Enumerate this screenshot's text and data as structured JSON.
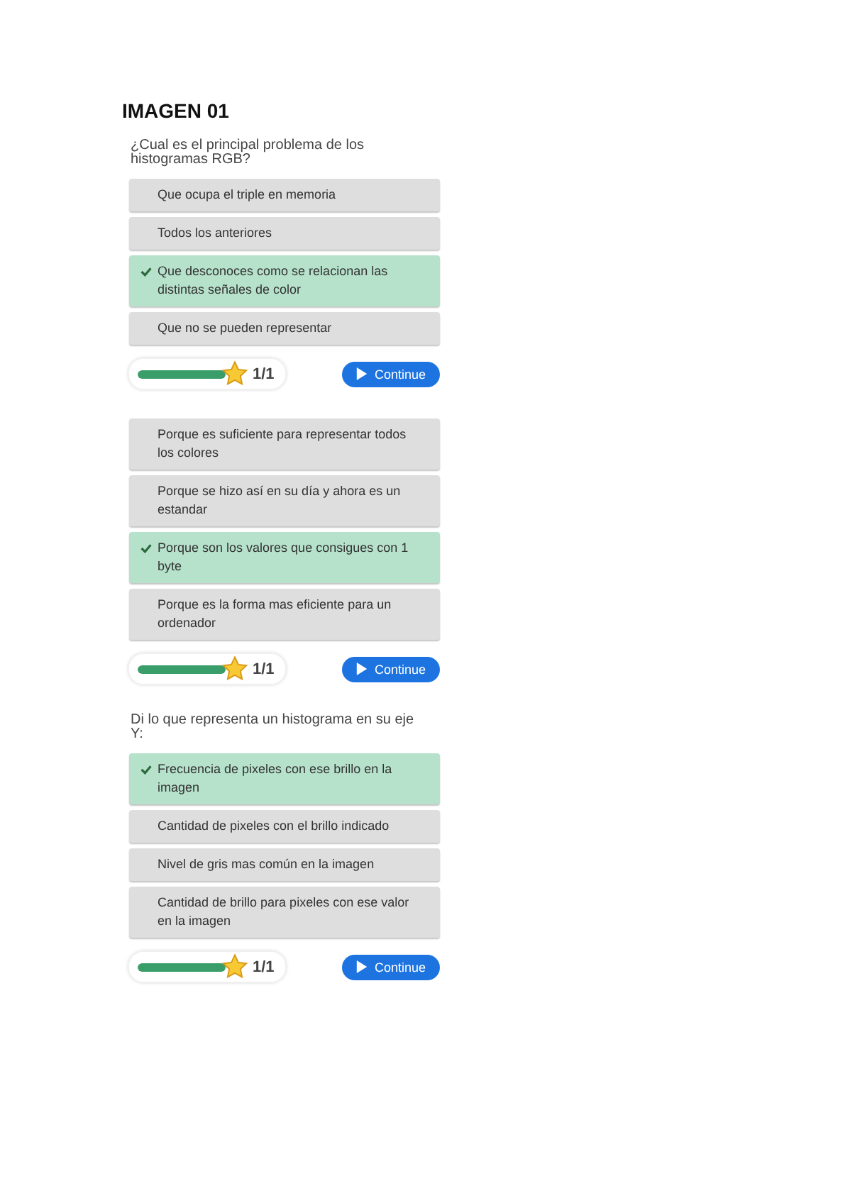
{
  "heading": "IMAGEN 01",
  "quizzes": [
    {
      "question": "¿Cual es el principal problema de los histogramas RGB?",
      "options": [
        {
          "text": "Que ocupa el triple en memoria",
          "selected": false
        },
        {
          "text": "Todos los anteriores",
          "selected": false
        },
        {
          "text": "Que desconoces como se relacionan las distintas señales de color",
          "selected": true
        },
        {
          "text": "Que no se pueden representar",
          "selected": false
        }
      ],
      "progress": {
        "level": 1,
        "count": "1/1"
      },
      "button": "Continue"
    },
    {
      "options": [
        {
          "text": "Porque es suficiente para representar todos los colores",
          "selected": false
        },
        {
          "text": "Porque se hizo así en su día y ahora es un estandar",
          "selected": false
        },
        {
          "text": "Porque son los valores que consigues con 1 byte",
          "selected": true
        },
        {
          "text": "Porque es la forma mas eficiente para un ordenador",
          "selected": false
        }
      ],
      "progress": {
        "level": 1,
        "count": "1/1"
      },
      "button": "Continue"
    },
    {
      "question": "Di lo que representa un histograma en su eje Y:",
      "options": [
        {
          "text": "Frecuencia de pixeles con ese brillo en la imagen",
          "selected": true
        },
        {
          "text": "Cantidad de pixeles con el brillo indicado",
          "selected": false
        },
        {
          "text": "Nivel de gris mas común en la imagen",
          "selected": false
        },
        {
          "text": "Cantidad de brillo para pixeles con ese valor en la imagen",
          "selected": false
        }
      ],
      "progress": {
        "level": 1,
        "count": "1/1"
      },
      "button": "Continue"
    }
  ]
}
